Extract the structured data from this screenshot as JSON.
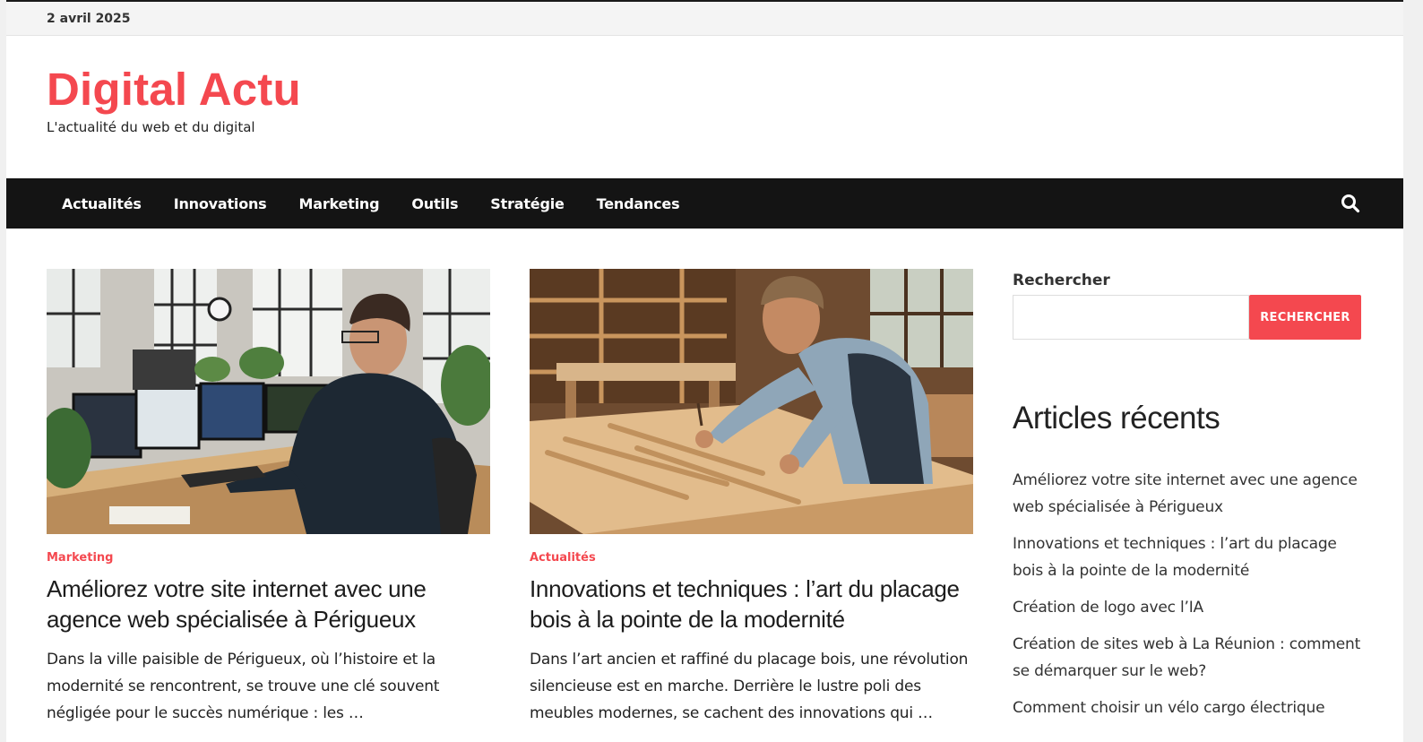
{
  "topbar": {
    "date": "2 avril 2025"
  },
  "header": {
    "site_title": "Digital Actu",
    "tagline": "L'actualité du web et du digital"
  },
  "nav": {
    "items": [
      "Actualités",
      "Innovations",
      "Marketing",
      "Outils",
      "Stratégie",
      "Tendances"
    ],
    "search_icon": "search-icon"
  },
  "posts": [
    {
      "category": "Marketing",
      "title": "Améliorez votre site internet avec une agence web spécialisée à Périgueux",
      "excerpt": "Dans la ville paisible de Périgueux, où l’histoire et la modernité se rencontrent, se trouve une clé souvent négligée pour le succès numérique : les …"
    },
    {
      "category": "Actualités",
      "title": "Innovations et techniques : l’art du placage bois à la pointe de la modernité",
      "excerpt": "Dans l’art ancien et raffiné du placage bois, une révolution silencieuse est en marche. Derrière le lustre poli des meubles modernes, se cachent des innovations qui …"
    }
  ],
  "sidebar": {
    "search_label": "Rechercher",
    "search_value": "",
    "search_button": "RECHERCHER",
    "recent_heading": "Articles récents",
    "recent_items": [
      "Améliorez votre site internet avec une agence web spécialisée à Périgueux",
      "Innovations et techniques : l’art du placage bois à la pointe de la modernité",
      "Création de logo avec l’IA",
      "Création de sites web à La Réunion : comment se démarquer sur le web?",
      "Comment choisir un vélo cargo électrique"
    ]
  },
  "colors": {
    "accent": "#f4484f",
    "nav_bg": "#141414",
    "topbar_bg": "#f4f4f4"
  }
}
